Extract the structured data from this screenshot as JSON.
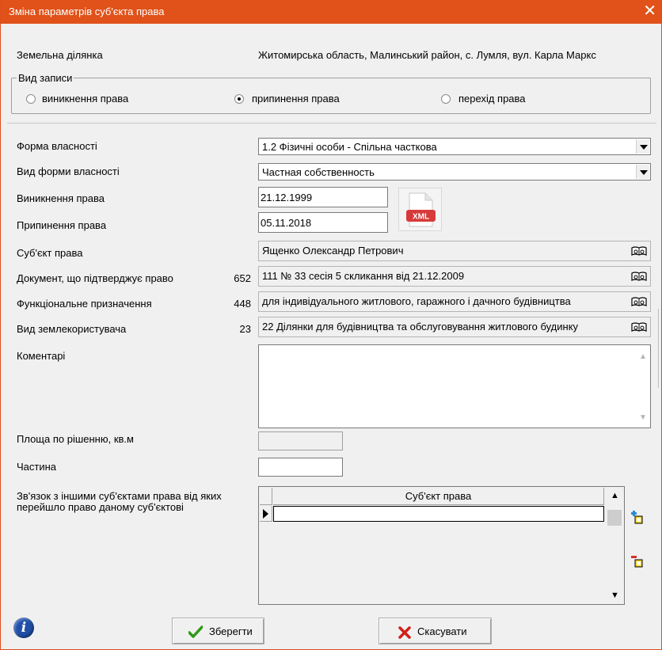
{
  "window": {
    "title": "Зміна параметрів суб'єкта права",
    "close_symbol": "✕"
  },
  "land_plot": {
    "label": "Земельна ділянка",
    "value": "Житомирська область, Малинський район, с. Лумля, вул. Карла Маркс"
  },
  "record_type": {
    "legend": "Вид записи",
    "options": [
      {
        "label": "виникнення права",
        "checked": false
      },
      {
        "label": "припинення права",
        "checked": true
      },
      {
        "label": "перехід права",
        "checked": false
      }
    ]
  },
  "fields": {
    "ownership_form": {
      "label": "Форма власності",
      "value": "1.2 Фізичні особи - Спільна часткова"
    },
    "ownership_kind": {
      "label": "Вид форми власності",
      "value": "Частная собственность"
    },
    "right_start": {
      "label": "Виникнення права",
      "value": "21.12.1999"
    },
    "right_end": {
      "label": "Припинення права",
      "value": "05.11.2018"
    },
    "subject": {
      "label": "Суб'єкт права",
      "value": "Ященко Олександр Петрович"
    },
    "document": {
      "label": "Документ, що підтверджує право",
      "code": "652",
      "value": "111 № 33 сесія 5 скликання від 21.12.2009"
    },
    "purpose": {
      "label": "Функціональне призначення",
      "code": "448",
      "value": "для індивідуального житлового, гаражного і дачного будівництва"
    },
    "user_type": {
      "label": "Вид землекористувача",
      "code": "23",
      "value": "22 Ділянки для будівництва та обслуговування житлового будинку"
    },
    "comments": {
      "label": "Коментарі",
      "value": ""
    },
    "area": {
      "label": "Площа по рішенню, кв.м",
      "value": ""
    },
    "share": {
      "label": "Частина",
      "value": ""
    }
  },
  "relations": {
    "label": "Зв'язок з іншими суб'єктами права від яких перейшло право даному суб'єктові",
    "column_header": "Суб'єкт права"
  },
  "xml_badge": "XML",
  "info_symbol": "i",
  "buttons": {
    "save": "Зберегти",
    "cancel": "Скасувати"
  },
  "colors": {
    "titlebar": "#e0521a",
    "save_check": "#2e9a1a",
    "cancel_x": "#d0201a",
    "xml_red": "#d83a3a"
  }
}
